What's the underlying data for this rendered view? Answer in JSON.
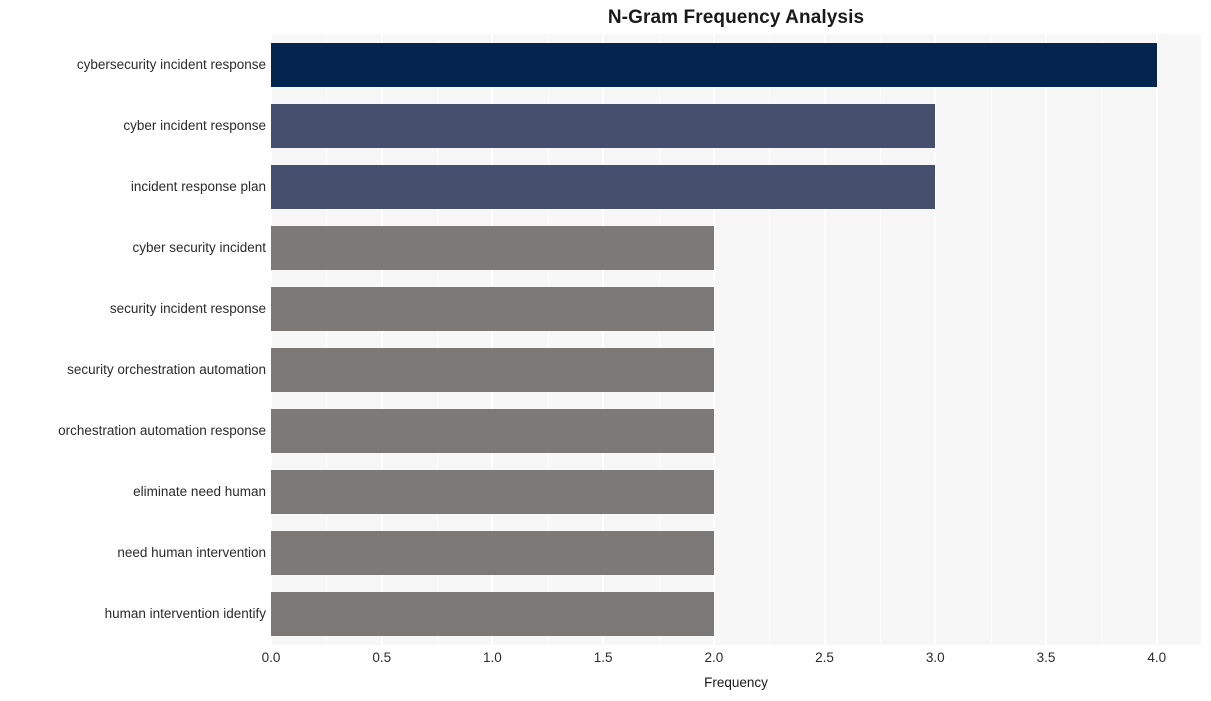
{
  "chart_data": {
    "type": "bar",
    "orientation": "horizontal",
    "title": "N-Gram Frequency Analysis",
    "xlabel": "Frequency",
    "ylabel": "",
    "xlim": [
      0.0,
      4.2
    ],
    "xticks": [
      "0.0",
      "0.5",
      "1.0",
      "1.5",
      "2.0",
      "2.5",
      "3.0",
      "3.5",
      "4.0"
    ],
    "xtick_values": [
      0.0,
      0.5,
      1.0,
      1.5,
      2.0,
      2.5,
      3.0,
      3.5,
      4.0
    ],
    "grid": true,
    "grid_axis": "x",
    "legend": "none",
    "categories": [
      "cybersecurity incident response",
      "cyber incident response",
      "incident response plan",
      "cyber security incident",
      "security incident response",
      "security orchestration automation",
      "orchestration automation response",
      "eliminate need human",
      "need human intervention",
      "human intervention identify"
    ],
    "values": [
      4,
      3,
      3,
      2,
      2,
      2,
      2,
      2,
      2,
      2
    ],
    "bar_colors": [
      "#04254f",
      "#45506f",
      "#45506f",
      "#7b7a78",
      "#7b7a78",
      "#7b7a78",
      "#7b7a78",
      "#7b7a78",
      "#7b7a78",
      "#7b7a78"
    ]
  },
  "style": {
    "plot_background": "#f7f7f7",
    "figure_background": "#ffffff",
    "gridline_color": "#ffffff",
    "text_color": "#2b2b2b",
    "title_color": "#1a1a1a"
  }
}
